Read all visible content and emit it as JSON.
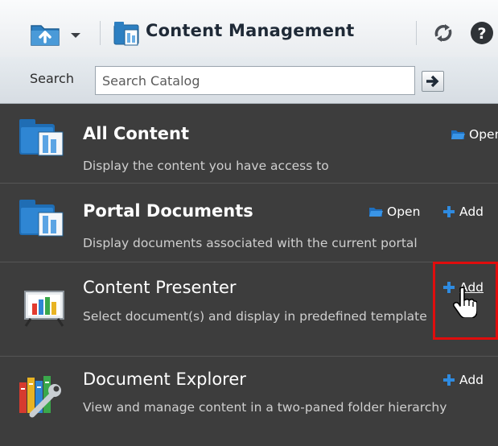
{
  "toolbar": {
    "title": "Content Management",
    "icons": [
      "folder-up-icon",
      "chevron-down-icon",
      "content-management-icon",
      "refresh-icon",
      "help-icon"
    ]
  },
  "search": {
    "label": "Search",
    "placeholder": "Search Catalog"
  },
  "items": [
    {
      "title": "All Content",
      "description": "Display the content you have access to",
      "open_label": "Open",
      "icon": "folder-stack-icon"
    },
    {
      "title": "Portal Documents",
      "description": "Display documents associated with the current portal",
      "open_label": "Open",
      "add_label": "Add",
      "icon": "folder-stack-icon"
    },
    {
      "title": "Content Presenter",
      "description": "Select document(s) and display in predefined template",
      "add_label": "Add",
      "icon": "presenter-chart-icon"
    },
    {
      "title": "Document Explorer",
      "description": "View and manage content in a two-paned folder hierarchy",
      "add_label": "Add",
      "icon": "books-wrench-icon"
    }
  ],
  "colors": {
    "panel_bg": "#3d3d3d",
    "toolbar_bg": "#f2f4f6",
    "highlight": "#e00d0d",
    "add_plus": "#2f8be0",
    "open_folder": "#2f8be0"
  }
}
